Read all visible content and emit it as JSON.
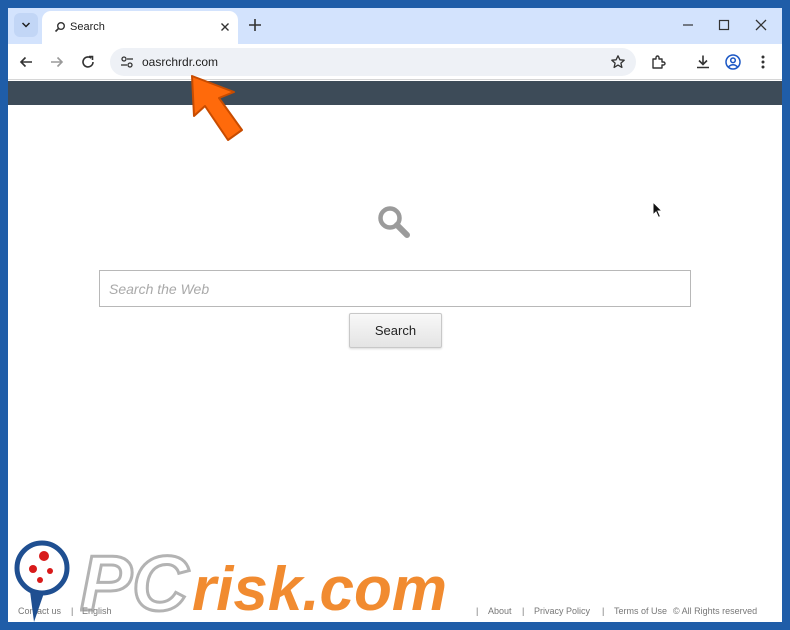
{
  "browser": {
    "tab": {
      "title": "Search"
    },
    "address": {
      "url": "oasrchrdr.com"
    }
  },
  "page": {
    "search": {
      "placeholder": "Search the Web",
      "button_label": "Search"
    },
    "footer": {
      "left": [
        "Contact us",
        "English"
      ],
      "right": [
        "About",
        "Privacy Policy",
        "Terms of Use",
        "© All Rights reserved"
      ],
      "separator": "|"
    }
  },
  "watermark": {
    "text": "PCrisk.com"
  },
  "colors": {
    "frame": "#1f5da8",
    "tabstrip": "#d3e3fd",
    "header_bar": "#3d4b58",
    "arrow": "#ff6a0b",
    "watermark_orange": "#f07f1a"
  }
}
